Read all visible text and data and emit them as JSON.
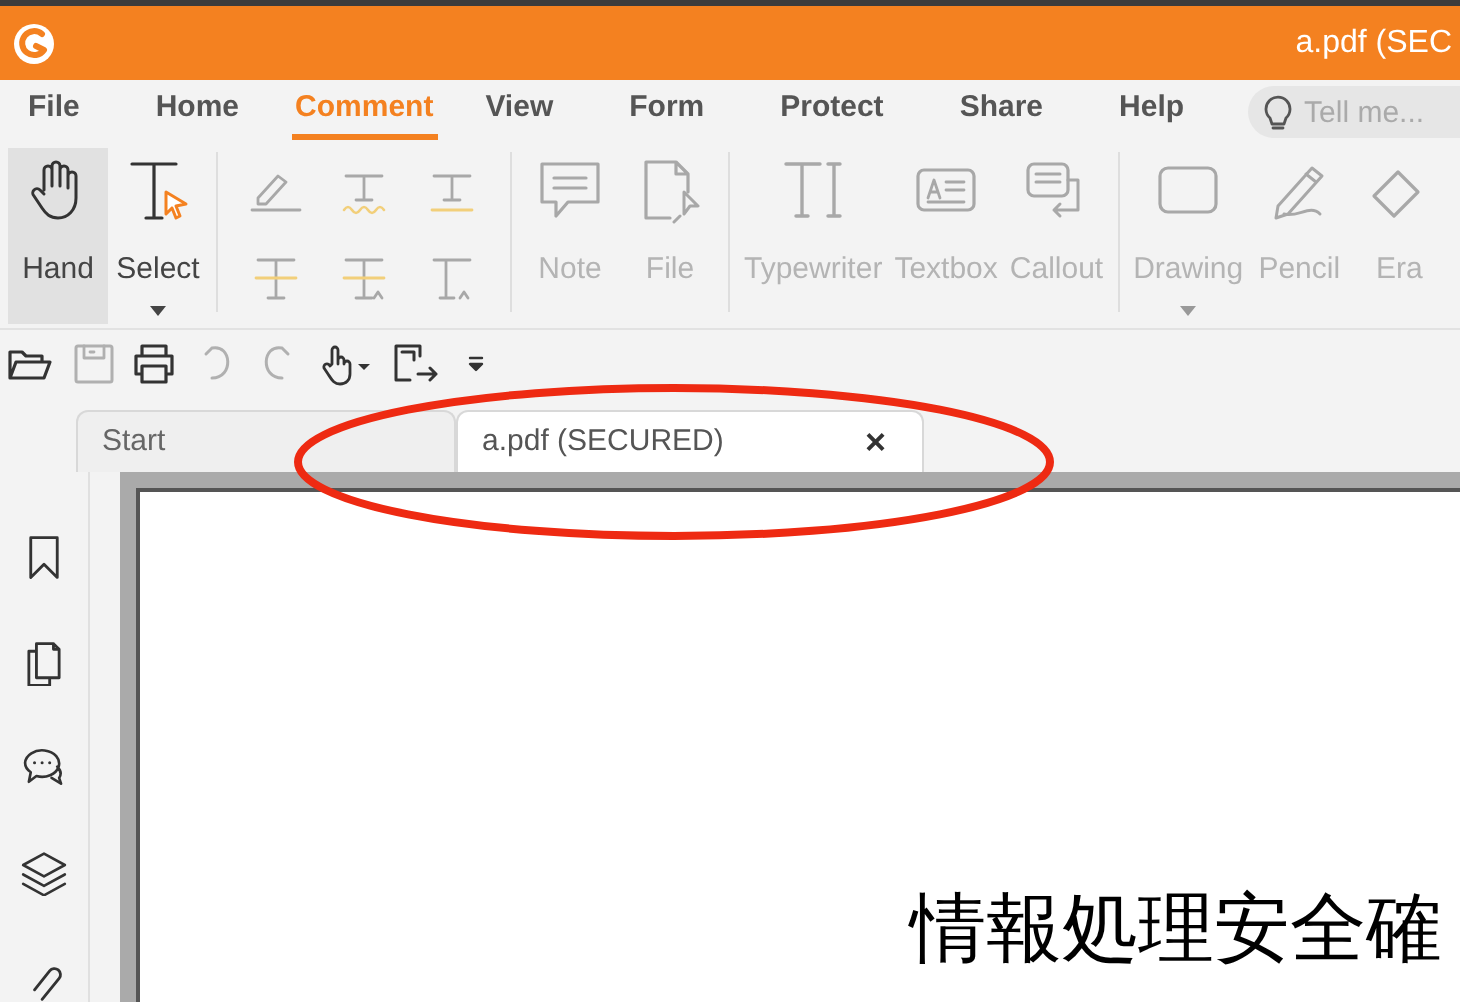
{
  "window": {
    "title": "a.pdf (SEC"
  },
  "menu_tabs": [
    {
      "label": "File",
      "selected": false
    },
    {
      "label": "Home",
      "selected": false
    },
    {
      "label": "Comment",
      "selected": true
    },
    {
      "label": "View",
      "selected": false
    },
    {
      "label": "Form",
      "selected": false
    },
    {
      "label": "Protect",
      "selected": false
    },
    {
      "label": "Share",
      "selected": false
    },
    {
      "label": "Help",
      "selected": false
    }
  ],
  "search": {
    "placeholder": "Tell me..."
  },
  "ribbon_groups": [
    {
      "items": [
        {
          "kind": "large",
          "label": "Hand",
          "selected": true,
          "disabled": false,
          "dropdown": false
        },
        {
          "kind": "large",
          "label": "Select",
          "selected": false,
          "disabled": false,
          "dropdown": true
        }
      ]
    },
    {
      "items": [
        {
          "kind": "small",
          "disabled": true
        },
        {
          "kind": "small",
          "disabled": true
        },
        {
          "kind": "small",
          "disabled": true
        },
        {
          "kind": "small",
          "disabled": true
        },
        {
          "kind": "small",
          "disabled": true
        },
        {
          "kind": "small",
          "disabled": true
        }
      ]
    },
    {
      "items": [
        {
          "kind": "large",
          "label": "Note",
          "selected": false,
          "disabled": true,
          "dropdown": false
        },
        {
          "kind": "large",
          "label": "File",
          "selected": false,
          "disabled": true,
          "dropdown": false
        }
      ]
    },
    {
      "items": [
        {
          "kind": "large",
          "label": "Typewriter",
          "selected": false,
          "disabled": true,
          "dropdown": false
        },
        {
          "kind": "large",
          "label": "Textbox",
          "selected": false,
          "disabled": true,
          "dropdown": false
        },
        {
          "kind": "large",
          "label": "Callout",
          "selected": false,
          "disabled": true,
          "dropdown": false
        }
      ]
    },
    {
      "items": [
        {
          "kind": "large",
          "label": "Drawing",
          "selected": false,
          "disabled": true,
          "dropdown": true
        },
        {
          "kind": "large",
          "label": "Pencil",
          "selected": false,
          "disabled": true,
          "dropdown": false
        },
        {
          "kind": "large",
          "label": "Era",
          "selected": false,
          "disabled": true,
          "dropdown": false
        }
      ]
    }
  ],
  "quick_access": [
    {
      "disabled": false
    },
    {
      "disabled": true
    },
    {
      "disabled": false
    },
    {
      "disabled": true
    },
    {
      "disabled": true
    },
    {
      "disabled": false
    },
    {
      "disabled": false
    },
    {
      "disabled": false
    }
  ],
  "doc_tabs": [
    {
      "label": "Start",
      "selected": false
    },
    {
      "label": "a.pdf (SECURED)",
      "selected": true,
      "close": "×"
    }
  ],
  "document": {
    "text": "情報処理安全確"
  }
}
